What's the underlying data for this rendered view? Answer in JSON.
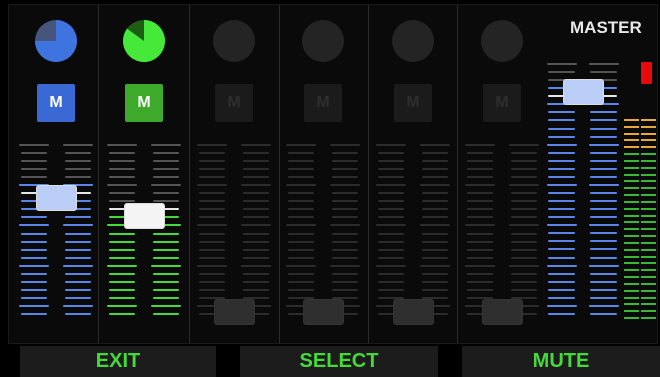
{
  "master": {
    "label": "MASTER",
    "clip_color": "#e50b0b"
  },
  "colors": {
    "blue_tick": "#5b86e6",
    "green_tick": "#45d93a",
    "white_tick": "#e6e6e6",
    "dim_tick": "#2c2c2c",
    "blue_button": "#3a68d4",
    "green_button": "#3daa2c",
    "bottom_text": "#45d93a",
    "vu_green": "#38b833",
    "vu_yellow": "#e6a83a"
  },
  "channels": [
    {
      "name": "channel-1",
      "state": "active",
      "accent": "blue",
      "mute_label": "M",
      "knob_fill": 0.75,
      "fader_level": 0.71
    },
    {
      "name": "channel-2",
      "state": "active",
      "accent": "green",
      "mute_label": "M",
      "knob_fill": 0.85,
      "fader_level": 0.6
    },
    {
      "name": "channel-3",
      "state": "empty",
      "mute_label": "M",
      "fader_level": 0.0
    },
    {
      "name": "channel-4",
      "state": "empty",
      "mute_label": "M",
      "fader_level": 0.0
    },
    {
      "name": "channel-5",
      "state": "empty",
      "mute_label": "M",
      "fader_level": 0.0
    },
    {
      "name": "channel-6",
      "state": "empty",
      "mute_label": "M",
      "fader_level": 0.0
    }
  ],
  "master_fader_level": 0.88,
  "bottom_buttons": [
    {
      "label": "EXIT"
    },
    {
      "label": "SELECT"
    },
    {
      "label": "MUTE"
    }
  ]
}
